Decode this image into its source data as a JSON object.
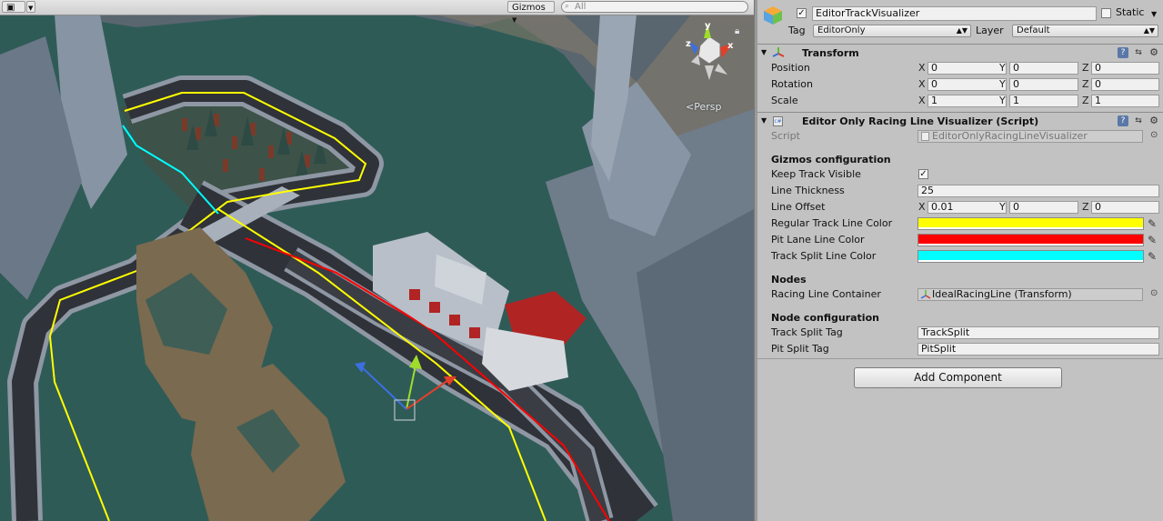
{
  "scene": {
    "gizmos_label": "Gizmos",
    "search_placeholder": "All",
    "persp_label": "Persp",
    "gizmo_axes": {
      "y": "y",
      "x": "x",
      "z": "z"
    }
  },
  "inspector": {
    "object_name": "EditorTrackVisualizer",
    "static_label": "Static",
    "tag_label": "Tag",
    "tag_value": "EditorOnly",
    "layer_label": "Layer",
    "layer_value": "Default",
    "transform": {
      "title": "Transform",
      "rows": [
        {
          "label": "Position",
          "x": "0",
          "y": "0",
          "z": "0"
        },
        {
          "label": "Rotation",
          "x": "0",
          "y": "0",
          "z": "0"
        },
        {
          "label": "Scale",
          "x": "1",
          "y": "1",
          "z": "1"
        }
      ]
    },
    "script_component": {
      "title": "Editor Only Racing Line Visualizer (Script)",
      "script_label": "Script",
      "script_value": "EditorOnlyRacingLineVisualizer",
      "gizmos_section": "Gizmos configuration",
      "keep_track_visible_label": "Keep Track Visible",
      "line_thickness_label": "Line Thickness",
      "line_thickness_value": "25",
      "line_offset_label": "Line Offset",
      "line_offset": {
        "x": "0.01",
        "y": "0",
        "z": "0"
      },
      "regular_color_label": "Regular Track Line Color",
      "pit_color_label": "Pit Lane Line Color",
      "split_color_label": "Track Split Line Color",
      "colors": {
        "regular": "#ffff00",
        "pit": "#ff0000",
        "split": "#00ffff"
      },
      "nodes_section": "Nodes",
      "racing_line_container_label": "Racing Line Container",
      "racing_line_container_value": "IdealRacingLine (Transform)",
      "node_config_section": "Node configuration",
      "track_split_tag_label": "Track Split Tag",
      "track_split_tag_value": "TrackSplit",
      "pit_split_tag_label": "Pit Split Tag",
      "pit_split_tag_value": "PitSplit"
    },
    "axis_labels": {
      "x": "X",
      "y": "Y",
      "z": "Z"
    },
    "add_component_label": "Add Component"
  }
}
